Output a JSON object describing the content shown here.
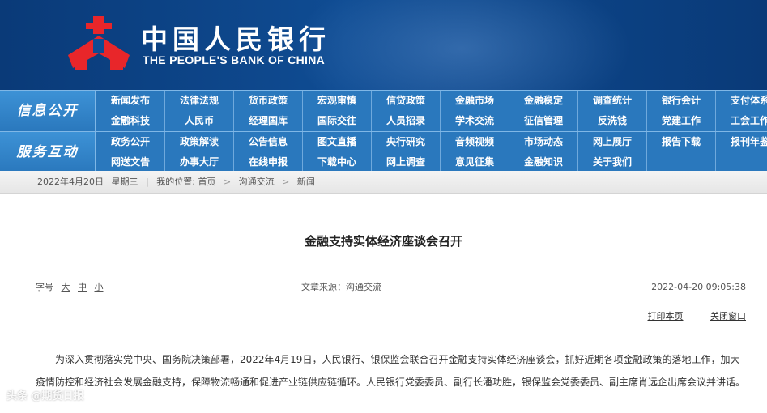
{
  "header": {
    "bank_name_cn": "中国人民银行",
    "bank_name_en": "THE PEOPLE'S BANK OF CHINA",
    "emblem_color": "#e8262a",
    "bg_color": "#0f4c93"
  },
  "nav": {
    "group1_label": "信息公开",
    "group2_label": "服务互动",
    "group1_items": [
      "新闻发布",
      "法律法规",
      "货币政策",
      "宏观审慎",
      "信贷政策",
      "金融市场",
      "金融稳定",
      "调查统计",
      "银行会计",
      "支付体系",
      "金融科技",
      "人民币",
      "经理国库",
      "国际交往",
      "人员招录",
      "学术交流",
      "征信管理",
      "反洗钱",
      "党建工作",
      "工会工作"
    ],
    "group2_items": [
      "政务公开",
      "政策解读",
      "公告信息",
      "图文直播",
      "央行研究",
      "音频视频",
      "市场动态",
      "网上展厅",
      "报告下载",
      "报刊年鉴",
      "网送文告",
      "办事大厅",
      "在线申报",
      "下载中心",
      "网上调查",
      "意见征集",
      "金融知识",
      "关于我们",
      "",
      ""
    ]
  },
  "breadcrumb": {
    "date": "2022年4月20日",
    "weekday": "星期三",
    "location_label": "我的位置:",
    "items": [
      "首页",
      "沟通交流",
      "新闻"
    ]
  },
  "article": {
    "title": "金融支持实体经济座谈会召开",
    "font_size_label": "字号",
    "font_sizes": [
      "大",
      "中",
      "小"
    ],
    "source": "文章来源：沟通交流",
    "datetime": "2022-04-20 09:05:38",
    "print_label": "打印本页",
    "close_label": "关闭窗口",
    "body": "为深入贯彻落实党中央、国务院决策部署，2022年4月19日，人民银行、银保监会联合召开金融支持实体经济座谈会，抓好近期各项金融政策的落地工作，加大疫情防控和经济社会发展金融支持，保障物流畅通和促进产业链供应链循环。人民银行党委委员、副行长潘功胜，银保监会党委委员、副主席肖远企出席会议并讲话。"
  },
  "watermark": "头条 @期货日报"
}
